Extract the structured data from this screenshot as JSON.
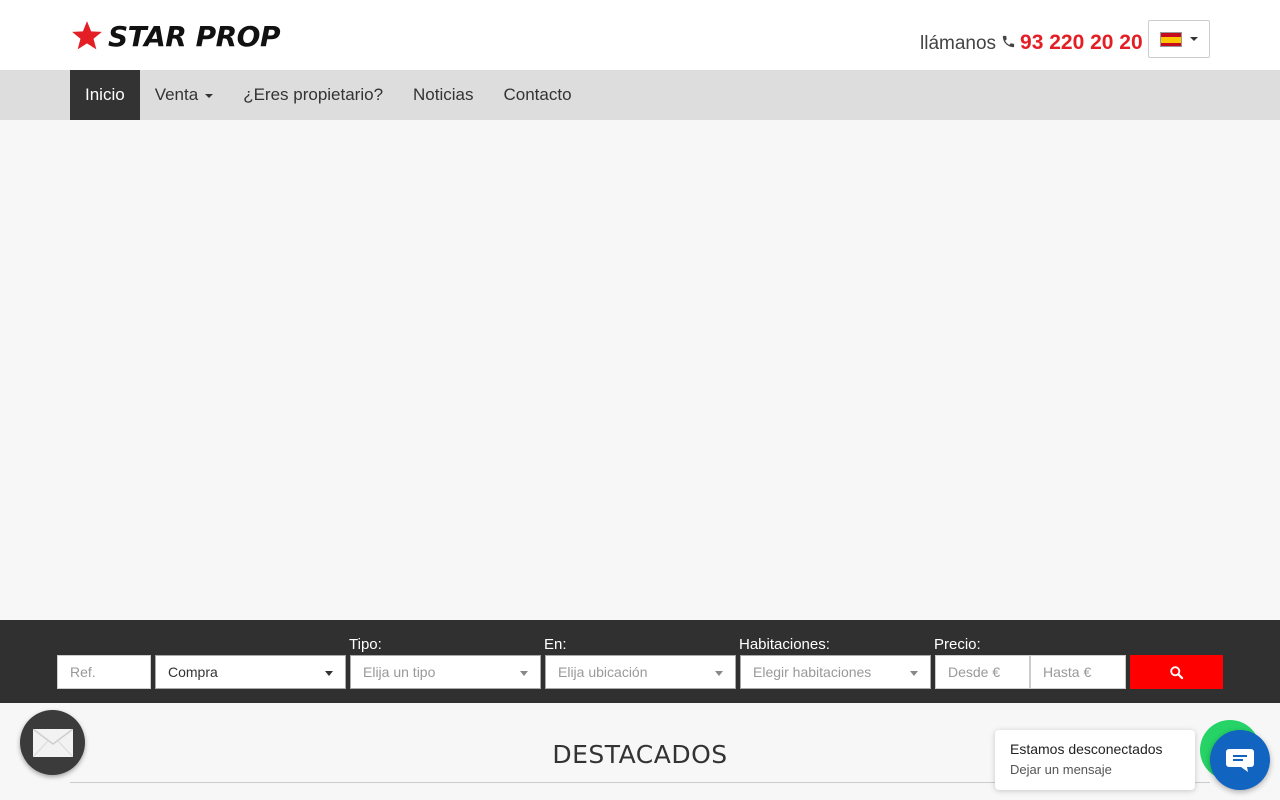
{
  "brand": {
    "name": "STAR PROP",
    "accent": "#e31e24"
  },
  "header": {
    "call_label": "llámanos",
    "phone": "93 220 20 20",
    "language": "Español"
  },
  "nav": {
    "items": [
      {
        "label": "Inicio",
        "active": true
      },
      {
        "label": "Venta",
        "dropdown": true
      },
      {
        "label": "¿Eres propietario?"
      },
      {
        "label": "Noticias"
      },
      {
        "label": "Contacto"
      }
    ]
  },
  "search": {
    "ref_placeholder": "Ref.",
    "operation_value": "Compra",
    "tipo_label": "Tipo:",
    "tipo_placeholder": "Elija un tipo",
    "en_label": "En:",
    "en_placeholder": "Elija ubicación",
    "habitaciones_label": "Habitaciones:",
    "habitaciones_placeholder": "Elegir habitaciones",
    "precio_label": "Precio:",
    "desde_placeholder": "Desde €",
    "hasta_placeholder": "Hasta €",
    "button_color": "#ff0000"
  },
  "featured": {
    "title": "DESTACADOS"
  },
  "chat": {
    "status": "Estamos desconectados",
    "subtitle": "Dejar un mensaje",
    "color": "#1164c0"
  },
  "icons": [
    "star-icon",
    "phone-icon",
    "spain-flag-icon",
    "search-icon",
    "mail-icon",
    "chat-icon",
    "whatsapp-icon"
  ]
}
